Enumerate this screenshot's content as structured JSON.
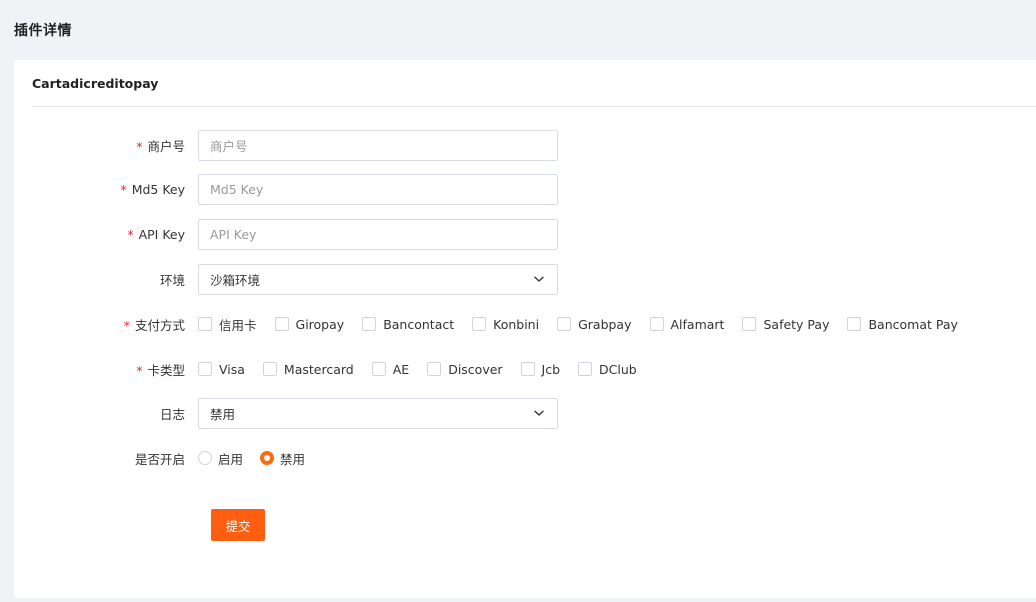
{
  "page": {
    "title": "插件详情"
  },
  "card": {
    "title": "Cartadicreditopay"
  },
  "form": {
    "merchant_no": {
      "label": "商户号",
      "required": true,
      "placeholder": "商户号"
    },
    "md5_key": {
      "label": "Md5 Key",
      "required": true,
      "placeholder": "Md5 Key"
    },
    "api_key": {
      "label": "API Key",
      "required": true,
      "placeholder": "API Key"
    },
    "environment": {
      "label": "环境",
      "selected": "沙箱环境"
    },
    "payment_methods": {
      "label": "支付方式",
      "required": true,
      "options": [
        "信用卡",
        "Giropay",
        "Bancontact",
        "Konbini",
        "Grabpay",
        "Alfamart",
        "Safety Pay",
        "Bancomat Pay"
      ]
    },
    "card_types": {
      "label": "卡类型",
      "required": true,
      "options": [
        "Visa",
        "Mastercard",
        "AE",
        "Discover",
        "Jcb",
        "DClub"
      ]
    },
    "log": {
      "label": "日志",
      "selected": "禁用"
    },
    "enabled": {
      "label": "是否开启",
      "options": [
        "启用",
        "禁用"
      ],
      "selected": "禁用"
    },
    "required_mark": "*",
    "submit_label": "提交"
  },
  "colors": {
    "accent": "#ff5d10",
    "required": "#f5222d"
  }
}
